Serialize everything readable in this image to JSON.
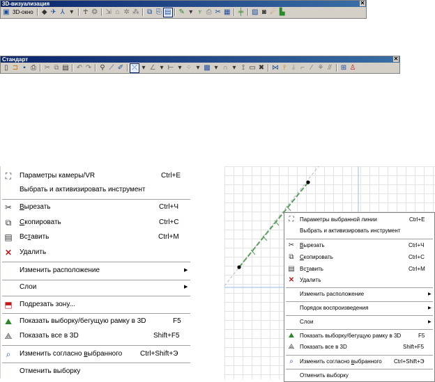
{
  "toolbar_3d": {
    "title": "3D-визуализация",
    "window_button_label": "3D-окно",
    "icons": [
      "3d-window-icon",
      "cube-icon",
      "camera-icon",
      "axis-icon",
      "dropdown-arrow",
      "walk-icon",
      "sun-icon",
      "cursor-icon",
      "house-icon",
      "light-icon",
      "grass-icon",
      "copy-view-icon",
      "paste-view-icon",
      "highlight-icon",
      "paint-icon",
      "dropdown-arrow",
      "figure-icon",
      "export-icon",
      "tools-icon",
      "table-icon",
      "ladder-icon",
      "image-icon",
      "camera-photo-icon",
      "render-icon",
      "terrain-icon"
    ]
  },
  "toolbar_standard": {
    "title": "Стандарт",
    "icons": [
      "new-icon",
      "open-icon",
      "save-icon",
      "print-icon",
      "cut-icon",
      "copy-icon",
      "paste-icon",
      "undo-icon",
      "redo-icon",
      "eyedropper-icon",
      "wand-icon",
      "pen-icon",
      "measure-icon",
      "dropdown-arrow",
      "angle-icon",
      "dropdown-arrow",
      "ruler-icon",
      "dropdown-arrow",
      "grid-icon",
      "dropdown-arrow",
      "layer-icon",
      "dropdown-arrow",
      "magnet-icon",
      "dropdown-arrow",
      "trace-icon",
      "window-icon",
      "delete-icon",
      "brackets-icon",
      "pin-icon",
      "pin2-icon",
      "line-icon",
      "slash-icon",
      "tree-icon",
      "chart-icon",
      "frame-icon",
      "help-icon"
    ]
  },
  "menu_main": {
    "camera": {
      "label": "Параметры камеры/VR",
      "shortcut": "Ctrl+E"
    },
    "select_tool": {
      "label": "Выбрать и активизировать инструмент"
    },
    "cut": {
      "label_pre": "",
      "label_key": "В",
      "label_post": "ырезать",
      "shortcut": "Ctrl+Ч"
    },
    "copy": {
      "label_pre": "",
      "label_key": "С",
      "label_post": "копировать",
      "shortcut": "Ctrl+C"
    },
    "paste": {
      "label_pre": "Вс",
      "label_key": "т",
      "label_post": "авить",
      "shortcut": "Ctrl+M"
    },
    "delete": {
      "label": "Удалить"
    },
    "arrange": {
      "label": "Изменить расположение"
    },
    "layers": {
      "label": "Слои"
    },
    "trim_zone": {
      "label": "Подрезать зону..."
    },
    "show_selection_3d": {
      "label": "Показать выборку/бегущую рамку в 3D",
      "shortcut": "F5"
    },
    "show_all_3d": {
      "label": "Показать все в 3D",
      "shortcut": "Shift+F5"
    },
    "change_by_selected": {
      "label_pre": "Изменить согласно ",
      "label_key": "в",
      "label_post": "ыбранного",
      "shortcut": "Ctrl+Shift+Э"
    },
    "deselect": {
      "label": "Отменить выборку"
    }
  },
  "menu_line": {
    "line_params": {
      "label": "Параметры выбранной линии",
      "shortcut": "Ctrl+E"
    },
    "select_tool": {
      "label": "Выбрать и активизировать инструмент"
    },
    "cut": {
      "label_pre": "",
      "label_key": "В",
      "label_post": "ырезать",
      "shortcut": "Ctrl+Ч"
    },
    "copy": {
      "label_pre": "",
      "label_key": "С",
      "label_post": "копировать",
      "shortcut": "Ctrl+C"
    },
    "paste": {
      "label_pre": "Вс",
      "label_key": "т",
      "label_post": "авить",
      "shortcut": "Ctrl+M"
    },
    "delete": {
      "label": "Удалить"
    },
    "arrange": {
      "label": "Изменить расположение"
    },
    "playback_order": {
      "label": "Порядок воспроизведения"
    },
    "layers": {
      "label": "Слои"
    },
    "show_selection_3d": {
      "label": "Показать выборку/бегущую рамку в 3D",
      "shortcut": "F5"
    },
    "show_all_3d": {
      "label": "Показать все в 3D",
      "shortcut": "Shift+F5"
    },
    "change_by_selected": {
      "label_pre": "Изменить согласно ",
      "label_key": "в",
      "label_post": "ыбранного",
      "shortcut": "Ctrl+Shift+Э"
    },
    "deselect": {
      "label": "Отменить выборку"
    }
  },
  "colors": {
    "title_bar": "#0a246a",
    "toolbar_bg": "#d4d0c8",
    "line": "#5aa05a",
    "guide": "#a9c6ea"
  }
}
